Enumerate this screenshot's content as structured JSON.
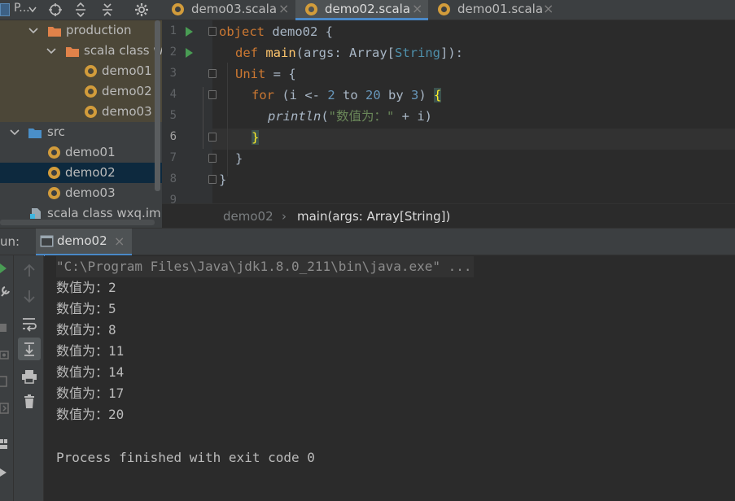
{
  "project_panel": {
    "title": "P...",
    "tree": [
      {
        "label": "production",
        "kind": "folder-orange",
        "expanded": true
      },
      {
        "label": "scala class wxq",
        "kind": "folder-orange",
        "expanded": true
      },
      {
        "label": "demo01",
        "kind": "object"
      },
      {
        "label": "demo02",
        "kind": "object"
      },
      {
        "label": "demo03",
        "kind": "object"
      },
      {
        "label": "src",
        "kind": "folder-blue",
        "expanded": true
      },
      {
        "label": "demo01",
        "kind": "object"
      },
      {
        "label": "demo02",
        "kind": "object",
        "selected": true
      },
      {
        "label": "demo03",
        "kind": "object"
      },
      {
        "label": "scala class wxq.iml",
        "kind": "module-file"
      }
    ]
  },
  "tabs": [
    {
      "label": "demo03.scala",
      "close": "×",
      "active": false
    },
    {
      "label": "demo02.scala",
      "close": "×",
      "active": true
    },
    {
      "label": "demo01.scala",
      "close": "×",
      "active": false
    }
  ],
  "editor": {
    "line_numbers": [
      "1",
      "2",
      "3",
      "4",
      "5",
      "6",
      "7",
      "8",
      "9"
    ],
    "code": {
      "l1_kw": "object",
      "l1_name": " demo02 {",
      "l2_kw": "def",
      "l2_fn": "main",
      "l2_a": "(args: ",
      "l2_b": "Array",
      "l2_c": "[",
      "l2_d": "String",
      "l2_e": "]):",
      "l3_a": "Unit",
      "l3_b": " = {",
      "l4_kw1": "for",
      "l4_a": " (i <- ",
      "l4_n1": "2",
      "l4_b": " ",
      "l4_kw2": "to",
      "l4_c": " ",
      "l4_n2": "20",
      "l4_d": " by ",
      "l4_n3": "3",
      "l4_e": ") ",
      "l4_brace": "{",
      "l5_fn": "println",
      "l5_a": "(",
      "l5_str": "\"数值为：\"",
      "l5_b": " + i)",
      "l6_brace": "}",
      "l7": "}",
      "l8": "}"
    },
    "current_line": 6
  },
  "breadcrumb": {
    "items": [
      "demo02",
      "main(args: Array[String])"
    ],
    "separator": "›"
  },
  "run_panel": {
    "label": "un:",
    "tab_label": "demo02",
    "tab_close": "×",
    "console_lines": [
      "\"C:\\Program Files\\Java\\jdk1.8.0_211\\bin\\java.exe\" ...",
      "数值为：2",
      "数值为：5",
      "数值为：8",
      "数值为：11",
      "数值为：14",
      "数值为：17",
      "数值为：20",
      "",
      "Process finished with exit code 0"
    ]
  },
  "colors": {
    "accent": "#4a88c7",
    "object_icon": "#d29c3b",
    "run_marker": "#499c54",
    "keyword": "#cc7832",
    "function": "#ffc66d",
    "number": "#6897bb",
    "string": "#6a8759"
  },
  "icons": [
    "project-icon",
    "chevron-down-icon",
    "locate-icon",
    "expand-all-icon",
    "collapse-all-icon",
    "settings-gear-icon",
    "folder-icon",
    "scala-object-icon",
    "module-file-icon",
    "run-gutter-icon",
    "fold-marker-icon",
    "up-arrow-icon",
    "down-arrow-icon",
    "soft-wrap-icon",
    "scroll-to-end-icon",
    "print-icon",
    "trash-icon",
    "rerun-icon",
    "wrench-icon",
    "stop-icon",
    "camera-icon",
    "exit-icon",
    "layout-icon",
    "pin-icon"
  ]
}
